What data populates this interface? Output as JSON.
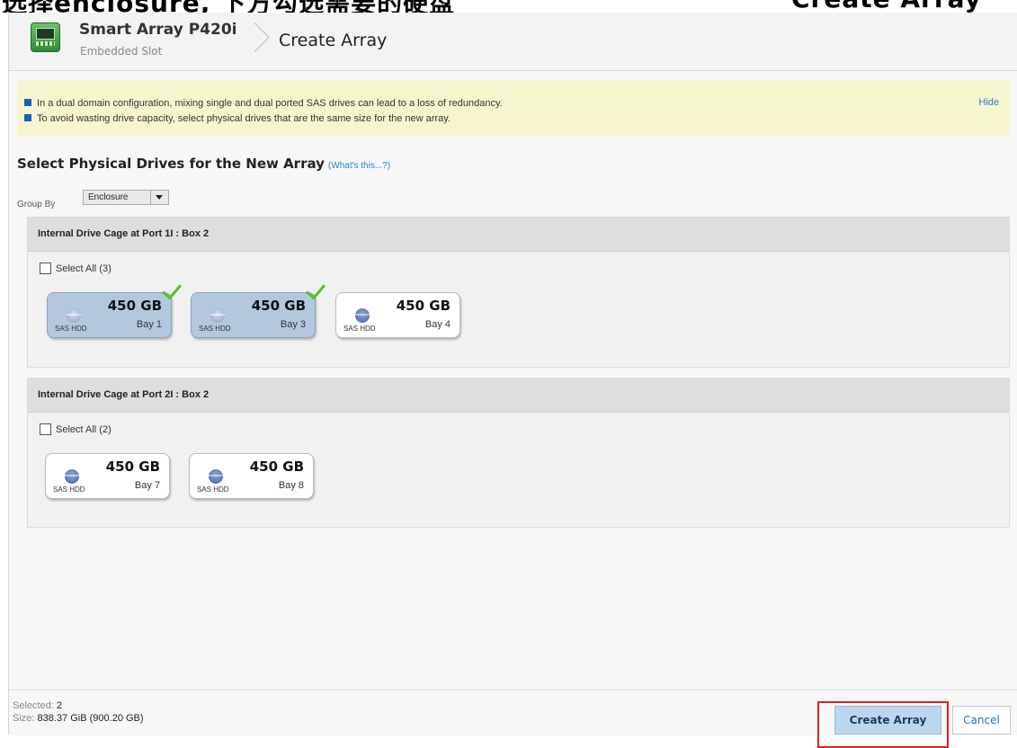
{
  "caption": {
    "cropped_text_left": "选择enclosure, 下方勾选需要的硬盘",
    "cropped_text_right": "Create Array"
  },
  "controller": {
    "name": "Smart Array P420i",
    "slot": "Embedded Slot"
  },
  "page_title": "Create Array",
  "notice": {
    "lines": [
      "In a dual domain configuration, mixing single and dual ported SAS drives can lead to a loss of redundancy.",
      "To avoid wasting drive capacity, select physical drives that are the same size for the new array."
    ],
    "hide_label": "Hide"
  },
  "section": {
    "title": "Select Physical Drives for the New Array",
    "help_link": "(What's this...?)"
  },
  "group_by": {
    "label": "Group By",
    "value": "Enclosure"
  },
  "cages": [
    {
      "title": "Internal Drive Cage at Port 1I : Box 2",
      "select_all": "Select All (3)",
      "drives": [
        {
          "capacity": "450 GB",
          "type": "SAS HDD",
          "bay": "Bay 1",
          "selected": true
        },
        {
          "capacity": "450 GB",
          "type": "SAS HDD",
          "bay": "Bay 3",
          "selected": true
        },
        {
          "capacity": "450 GB",
          "type": "SAS HDD",
          "bay": "Bay 4",
          "selected": false
        }
      ]
    },
    {
      "title": "Internal Drive Cage at Port 2I : Box 2",
      "select_all": "Select All (2)",
      "drives": [
        {
          "capacity": "450 GB",
          "type": "SAS HDD",
          "bay": "Bay 7",
          "selected": false
        },
        {
          "capacity": "450 GB",
          "type": "SAS HDD",
          "bay": "Bay 8",
          "selected": false
        }
      ]
    }
  ],
  "footer": {
    "selected_label": "Selected:",
    "selected_value": "2",
    "size_label": "Size:",
    "size_value": "838.37 GiB (900.20 GB)",
    "create_label": "Create Array",
    "cancel_label": "Cancel"
  },
  "colors": {
    "accent": "#2a7fd4",
    "selected_drive": "#b3c7dd",
    "highlight_box": "#e02020",
    "notice_bg": "#f5f6cf"
  }
}
